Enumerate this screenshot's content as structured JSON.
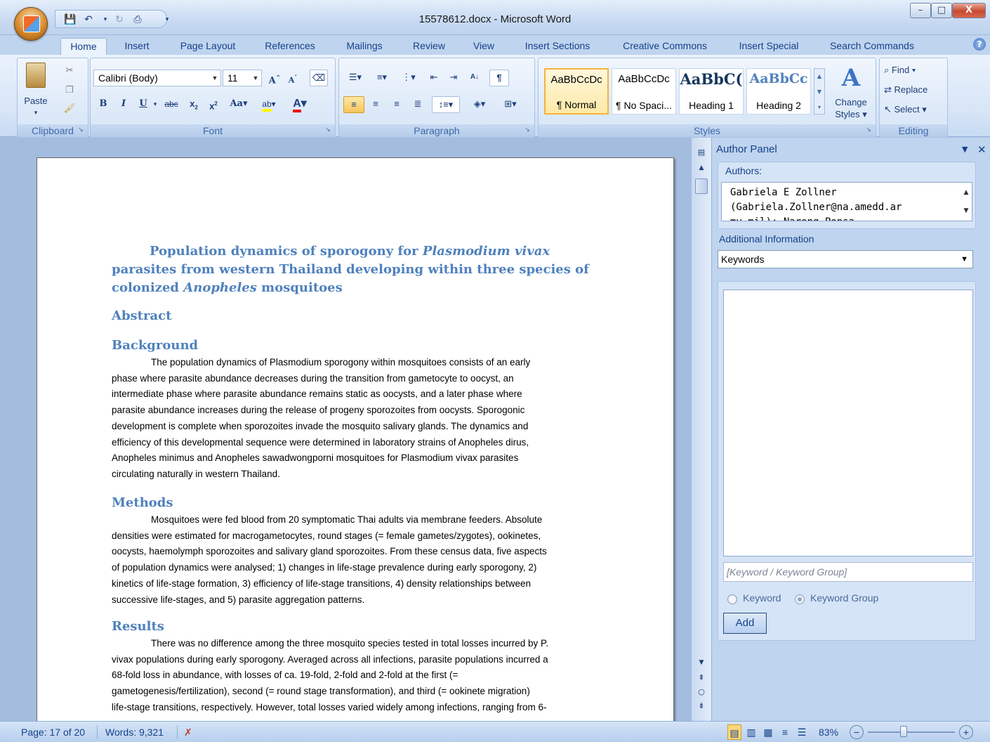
{
  "window": {
    "title": "15578612.docx - Microsoft Word",
    "minimize": "–",
    "maximize": "□",
    "close": "X"
  },
  "tabs": [
    "Home",
    "Insert",
    "Page Layout",
    "References",
    "Mailings",
    "Review",
    "View",
    "Insert Sections",
    "Creative Commons",
    "Insert Special",
    "Search Commands"
  ],
  "ribbon": {
    "clipboard": {
      "label": "Clipboard",
      "paste": "Paste"
    },
    "font": {
      "label": "Font",
      "name": "Calibri (Body)",
      "size": "11"
    },
    "paragraph": {
      "label": "Paragraph"
    },
    "styles": {
      "label": "Styles",
      "items": [
        {
          "preview": "AaBbCcDc",
          "name": "¶ Normal"
        },
        {
          "preview": "AaBbCcDc",
          "name": "¶ No Spaci..."
        },
        {
          "preview": "AaBbC(",
          "name": "Heading 1"
        },
        {
          "preview": "AaBbCc",
          "name": "Heading 2"
        }
      ],
      "change_line1": "Change",
      "change_line2": "Styles ▾"
    },
    "editing": {
      "label": "Editing",
      "find": "Find ▾",
      "replace": "Replace",
      "select": "Select ▾"
    }
  },
  "document": {
    "title_part1": "Population dynamics of sporogony for ",
    "title_italic1": "Plasmodium vivax",
    "title_part2": " parasites from western Thailand developing within three species of colonized ",
    "title_italic2": "Anopheles",
    "title_part3": " mosquitoes",
    "abstract": "Abstract",
    "background": "Background",
    "bg_lines": [
      "The population dynamics of Plasmodium sporogony within mosquitoes consists of an early",
      "phase where parasite abundance decreases during the transition from gametocyte to oocyst, an",
      "intermediate phase where parasite abundance remains static as oocysts, and a later phase where",
      "parasite abundance increases during the release of progeny sporozoites from oocysts. Sporogonic",
      "development is complete when sporozoites invade the mosquito salivary glands. The dynamics and",
      "efficiency of this developmental sequence were determined in laboratory strains of Anopheles dirus,",
      "Anopheles minimus and Anopheles sawadwongporni mosquitoes for Plasmodium vivax parasites",
      "circulating naturally in western Thailand."
    ],
    "methods": "Methods",
    "methods_lines": [
      "Mosquitoes were fed blood from 20 symptomatic Thai adults via membrane feeders. Absolute",
      "densities were estimated for macrogametocytes, round stages (= female gametes/zygotes), ookinetes,",
      "oocysts, haemolymph sporozoites and salivary gland sporozoites. From these census data, five aspects",
      "of population dynamics were analysed; 1) changes in life-stage prevalence during early sporogony, 2)",
      "kinetics of life-stage formation, 3) efficiency of life-stage transitions, 4) density relationships between",
      "successive life-stages, and 5) parasite aggregation patterns."
    ],
    "results": "Results",
    "results_lines": [
      "There was no difference among the three mosquito species tested in total losses incurred by P.",
      "vivax populations during early sporogony. Averaged across all infections, parasite populations incurred a",
      "68-fold loss in abundance, with losses of ca. 19-fold, 2-fold and 2-fold at the first (=",
      "gametogenesis/fertilization), second (= round stage transformation), and third (= ookinete migration)",
      "life-stage transitions, respectively. However, total losses varied widely among infections, ranging from 6-"
    ]
  },
  "author_panel": {
    "title": "Author Panel",
    "authors_label": "Authors:",
    "authors_lines": [
      "Gabriela E Zollner",
      "(Gabriela.Zollner@na.amedd.ar",
      "my.mil); Narong Ponsa"
    ],
    "additional_label": "Additional Information",
    "select_value": "Keywords",
    "keyword_placeholder": "[Keyword / Keyword Group]",
    "radio_keyword": "Keyword",
    "radio_group": "Keyword Group",
    "add_button": "Add"
  },
  "status": {
    "page": "Page: 17 of 20",
    "words": "Words: 9,321",
    "zoom": "83%"
  },
  "colors": {
    "heading": "#4f81bd",
    "accent": "#15428b"
  }
}
